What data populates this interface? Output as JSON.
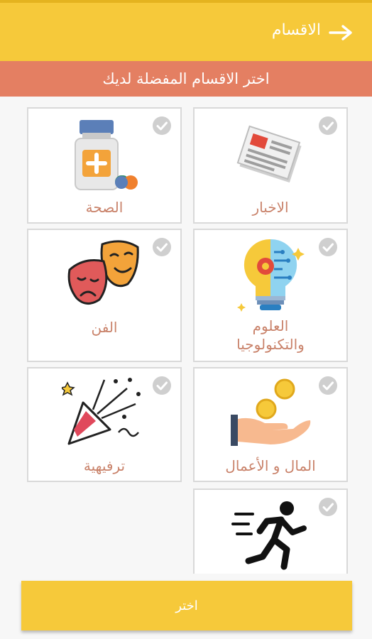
{
  "header": {
    "title": "الاقسام",
    "back_icon": "arrow-right-icon"
  },
  "subheader": {
    "text": "اختر الاقسام المفضلة لديك"
  },
  "categories": [
    {
      "label": "الاخبار",
      "icon": "newspaper-icon",
      "checked": false
    },
    {
      "label": "الصحة",
      "icon": "medicine-bottle-icon",
      "checked": false
    },
    {
      "label": "العلوم والتكنولوجيا",
      "icon": "tech-bulb-icon",
      "checked": false
    },
    {
      "label": "الفن",
      "icon": "theater-masks-icon",
      "checked": false
    },
    {
      "label": "المال و الأعمال",
      "icon": "money-hand-icon",
      "checked": false
    },
    {
      "label": "ترفيهية",
      "icon": "party-popper-icon",
      "checked": false
    },
    {
      "label": "",
      "icon": "running-man-icon",
      "checked": false
    }
  ],
  "colors": {
    "primary": "#f6c93a",
    "accent": "#e47f62",
    "label": "#c9826a",
    "check": "#cfcfcf"
  },
  "footer": {
    "button_label": "اختر"
  }
}
